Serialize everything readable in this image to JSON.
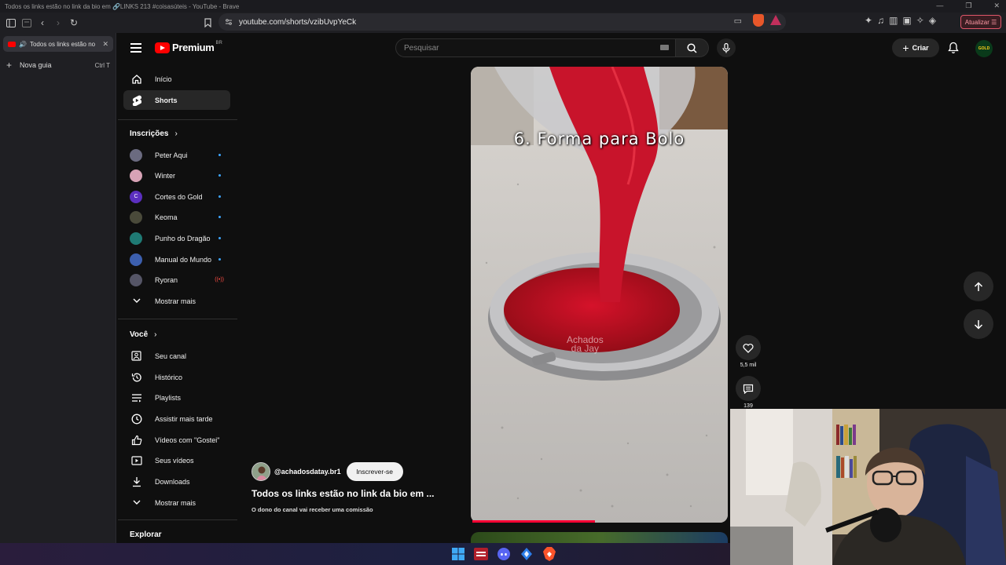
{
  "window": {
    "title": "Todos os links estão no link da bio em 🔗LINKS 213 #coisasúteis - YouTube - Brave"
  },
  "toolbar": {
    "url": "youtube.com/shorts/vzibUvpYeCk",
    "update_label": "Atualizar"
  },
  "browser_tabs": {
    "active_tab": "Todos os links estão no link da bio em 🔗LINKS 213 #coisasúteis - YouTube",
    "new_tab_label": "Nova guia",
    "new_tab_shortcut": "Ctrl T"
  },
  "header": {
    "logo_text": "Premium",
    "logo_region": "BR",
    "search_placeholder": "Pesquisar",
    "create_label": "Criar",
    "avatar_text": "GOLD"
  },
  "sidebar": {
    "main": [
      {
        "label": "Início",
        "icon": "home-icon"
      },
      {
        "label": "Shorts",
        "icon": "shorts-icon"
      }
    ],
    "subscriptions_title": "Inscrições",
    "subscriptions": [
      {
        "label": "Peter Aqui",
        "color": "#6b6b80",
        "letter": ""
      },
      {
        "label": "Winter",
        "color": "#d8a3b6",
        "letter": ""
      },
      {
        "label": "Cortes do Gold",
        "color": "#5b2fbf",
        "letter": "C"
      },
      {
        "label": "Keoma",
        "color": "#4a4a3a",
        "letter": ""
      },
      {
        "label": "Punho do Dragão",
        "color": "#1f7a74",
        "letter": ""
      },
      {
        "label": "Manual do Mundo",
        "color": "#3c5fae",
        "letter": ""
      },
      {
        "label": "Ryoran",
        "color": "#555566",
        "letter": ""
      }
    ],
    "show_more_1": "Mostrar mais",
    "you_title": "Você",
    "you_items": [
      {
        "label": "Seu canal",
        "icon": "channel-icon"
      },
      {
        "label": "Histórico",
        "icon": "history-icon"
      },
      {
        "label": "Playlists",
        "icon": "playlist-icon"
      },
      {
        "label": "Assistir mais tarde",
        "icon": "clock-icon"
      },
      {
        "label": "Vídeos com \"Gostei\"",
        "icon": "thumbs-up-icon"
      },
      {
        "label": "Seus vídeos",
        "icon": "video-icon"
      },
      {
        "label": "Downloads",
        "icon": "download-icon"
      }
    ],
    "show_more_2": "Mostrar mais",
    "explore_title": "Explorar"
  },
  "short": {
    "caption": "6. Forma para Bolo",
    "watermark_line1": "Achados",
    "watermark_line2": "da Jay",
    "channel_handle": "@achadosdatay.br1",
    "subscribe_label": "Inscrever-se",
    "title": "Todos os links estão no link da bio em ...",
    "note": "O dono do canal vai receber uma comissão",
    "likes": "5,5 mil",
    "comments": "139",
    "progress": 0.48
  }
}
